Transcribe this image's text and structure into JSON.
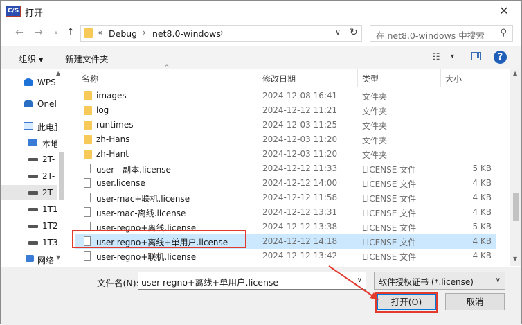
{
  "window": {
    "app_icon_text": "C/S",
    "title": "打开",
    "close_glyph": "✕"
  },
  "address": {
    "back_glyph": "←",
    "forward_glyph": "→",
    "history_glyph": "∨",
    "up_glyph": "↑",
    "prefix": "«",
    "crumbs": [
      "Debug",
      "net8.0-windows"
    ],
    "sep_glyph": "›",
    "dropdown_glyph": "∨",
    "refresh_glyph": "↻",
    "search_placeholder": "在 net8.0-windows 中搜索",
    "search_glyph": "⚲"
  },
  "toolbar": {
    "organize_label": "组织 ▾",
    "new_folder_label": "新建文件夹",
    "view_glyph": "☷",
    "view_dd_glyph": "▾",
    "help_glyph": "?"
  },
  "nav": {
    "items": [
      {
        "label": "WPS",
        "icon": "cloud-icon"
      },
      {
        "label": "OneI",
        "icon": "onedrive-icon"
      },
      {
        "label": "此电脑",
        "icon": "computer-icon"
      },
      {
        "label": "本地",
        "icon": "drive-icon"
      },
      {
        "label": "2T-",
        "icon": "drive-icon"
      },
      {
        "label": "2T-",
        "icon": "drive-icon"
      },
      {
        "label": "2T-",
        "icon": "drive-icon"
      },
      {
        "label": "1T1",
        "icon": "drive-icon"
      },
      {
        "label": "1T2",
        "icon": "drive-icon"
      },
      {
        "label": "1T3",
        "icon": "drive-icon"
      },
      {
        "label": "网络",
        "icon": "network-icon"
      }
    ]
  },
  "columns": {
    "name": "名称",
    "date": "修改日期",
    "type": "类型",
    "size": "大小"
  },
  "files": [
    {
      "name": "images",
      "date": "2024-12-08 16:41",
      "type": "文件夹",
      "size": "",
      "kind": "folder"
    },
    {
      "name": "log",
      "date": "2024-12-12 11:21",
      "type": "文件夹",
      "size": "",
      "kind": "folder"
    },
    {
      "name": "runtimes",
      "date": "2024-12-03 11:25",
      "type": "文件夹",
      "size": "",
      "kind": "folder"
    },
    {
      "name": "zh-Hans",
      "date": "2024-12-03 11:20",
      "type": "文件夹",
      "size": "",
      "kind": "folder"
    },
    {
      "name": "zh-Hant",
      "date": "2024-12-03 11:20",
      "type": "文件夹",
      "size": "",
      "kind": "folder"
    },
    {
      "name": "user - 副本.license",
      "date": "2024-12-12 11:33",
      "type": "LICENSE 文件",
      "size": "5 KB",
      "kind": "file"
    },
    {
      "name": "user.license",
      "date": "2024-12-12 14:00",
      "type": "LICENSE 文件",
      "size": "4 KB",
      "kind": "file"
    },
    {
      "name": "user-mac+联机.license",
      "date": "2024-12-12 11:58",
      "type": "LICENSE 文件",
      "size": "4 KB",
      "kind": "file"
    },
    {
      "name": "user-mac-离线.license",
      "date": "2024-12-12 13:31",
      "type": "LICENSE 文件",
      "size": "4 KB",
      "kind": "file"
    },
    {
      "name": "user-regno+离线.license",
      "date": "2024-12-12 13:38",
      "type": "LICENSE 文件",
      "size": "5 KB",
      "kind": "file"
    },
    {
      "name": "user-regno+离线+单用户.license",
      "date": "2024-12-12 14:18",
      "type": "LICENSE 文件",
      "size": "4 KB",
      "kind": "file",
      "selected": true
    },
    {
      "name": "user-regno+联机.license",
      "date": "2024-12-12 13:42",
      "type": "LICENSE 文件",
      "size": "4 KB",
      "kind": "file"
    }
  ],
  "bottom": {
    "filename_label": "文件名(N):",
    "filename_value": "user-regno+离线+单用户.license",
    "filetype_value": "软件授权证书 (*.license)",
    "dd_glyph": "∨",
    "open_label": "打开(O)",
    "cancel_label": "取消"
  },
  "colors": {
    "selection": "#cce8ff",
    "annotation": "#e23b2e",
    "folder": "#f6c958",
    "accent": "#0078d7"
  }
}
